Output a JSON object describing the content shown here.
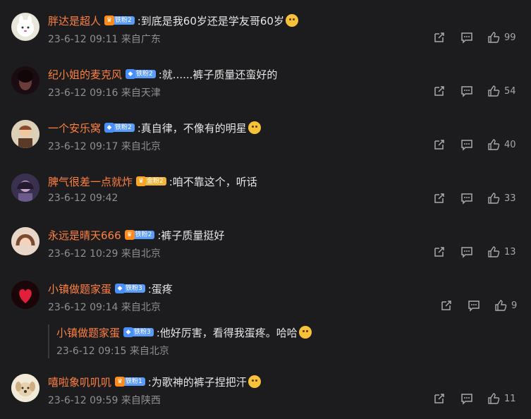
{
  "comments": [
    {
      "username": "胖达是超人",
      "badge_label": "铁粉2",
      "badge_style": "orange",
      "text": ":到底是我60岁还是学友哥60岁",
      "has_emoji": true,
      "time": "23-6-12 09:11",
      "location": "来自广东",
      "likes": "99",
      "avatar_color": "#e9e6dc"
    },
    {
      "username": "纪小姐的麦克风",
      "badge_label": "铁粉2",
      "badge_style": "blue",
      "text": ":就......裤子质量还蛮好的",
      "has_emoji": false,
      "time": "23-6-12 09:16",
      "location": "来自天津",
      "likes": "54",
      "avatar_color": "#2a1418"
    },
    {
      "username": "一个安乐窝",
      "badge_label": "铁粉2",
      "badge_style": "blue",
      "text": ":真自律，不像有的明星",
      "has_emoji": true,
      "time": "23-6-12 09:17",
      "location": "来自北京",
      "likes": "40",
      "avatar_color": "#c9b79a"
    },
    {
      "username": "脾气很差一点就炸",
      "badge_label": "金粉2",
      "badge_style": "gold",
      "text": ":咱不靠这个，听话",
      "has_emoji": false,
      "time": "23-6-12 09:42",
      "location": "",
      "likes": "33",
      "avatar_color": "#4b3e63"
    },
    {
      "username": "永远是晴天666",
      "badge_label": "铁粉2",
      "badge_style": "orange",
      "text": ":裤子质量挺好",
      "has_emoji": false,
      "time": "23-6-12 10:29",
      "location": "来自北京",
      "likes": "13",
      "avatar_color": "#d9b7a0"
    },
    {
      "username": "小镇做题家蛋",
      "badge_label": "铁粉3",
      "badge_style": "blue",
      "text": ":蛋疼",
      "has_emoji": false,
      "time": "23-6-12 09:14",
      "location": "来自北京",
      "likes": "9",
      "avatar_color": "#2b0b10"
    },
    {
      "username": "小镇做题家蛋",
      "badge_label": "铁粉3",
      "badge_style": "blue",
      "text": ":他好厉害，看得我蛋疼。哈哈",
      "has_emoji": true,
      "time": "23-6-12 09:15",
      "location": "来自北京",
      "likes": "",
      "avatar_color": ""
    },
    {
      "username": "嘻啦象叽叽叽",
      "badge_label": "铁粉1",
      "badge_style": "orange",
      "text": ":为歌神的裤子捏把汗",
      "has_emoji": true,
      "time": "23-6-12 09:59",
      "location": "来自陕西",
      "likes": "11",
      "avatar_color": "#efe6d6"
    }
  ],
  "icons": {
    "forward": "forward-icon",
    "comment": "comment-icon",
    "like": "like-icon"
  },
  "colors": {
    "background": "#1c1c1e",
    "username": "#ff8140",
    "meta": "#8f8f8f"
  }
}
